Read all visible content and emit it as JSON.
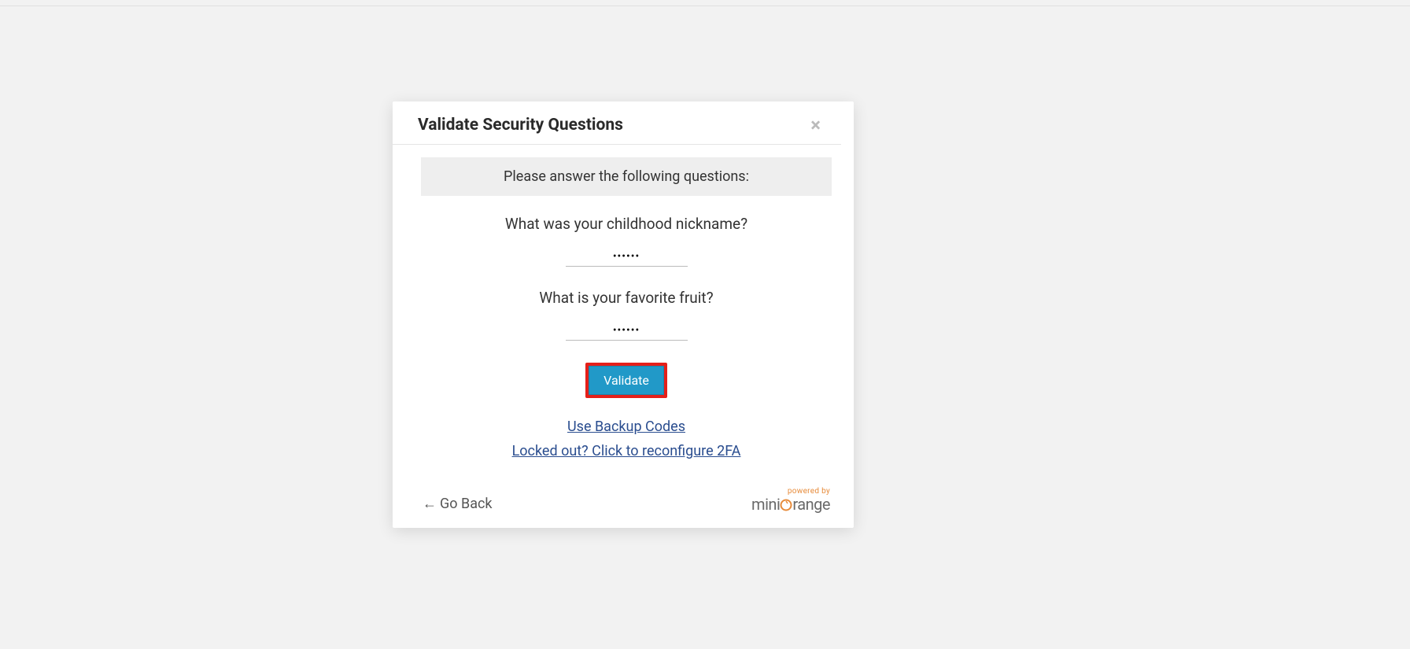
{
  "modal": {
    "title": "Validate Security Questions",
    "close": "×",
    "instruction": "Please answer the following questions:",
    "questions": [
      "What was your childhood nickname?",
      "What is your favorite fruit?"
    ],
    "answer_mask": "••••••",
    "validate_label": "Validate",
    "backup_link": "Use Backup Codes",
    "locked_link": "Locked out? Click to reconfigure 2FA",
    "go_back": "Go Back",
    "arrow": "←",
    "powered_by": "powered by",
    "brand_part1": "mini",
    "brand_o": "o",
    "brand_part2": "range"
  }
}
